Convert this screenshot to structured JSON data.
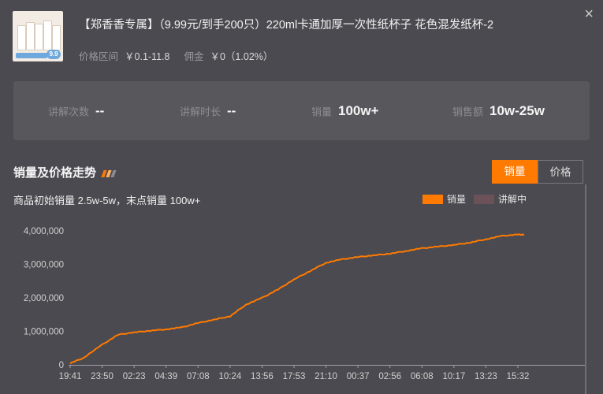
{
  "product": {
    "title": "【郑香香专属】（9.99元/到手200只）220ml卡通加厚一次性纸杯子 花色混发纸杯-2",
    "thumb_tag": "9.9",
    "price_label": "价格区间",
    "price_value": "￥0.1-11.8",
    "commission_label": "佣金",
    "commission_value": "￥0（1.02%）",
    "close_icon": "×"
  },
  "stats": [
    {
      "label": "讲解次数",
      "value": "--"
    },
    {
      "label": "讲解时长",
      "value": "--"
    },
    {
      "label": "销量",
      "value": "100w+"
    },
    {
      "label": "销售额",
      "value": "10w-25w"
    }
  ],
  "section": {
    "title": "销量及价格走势",
    "tabs": [
      {
        "label": "销量",
        "active": true
      },
      {
        "label": "价格",
        "active": false
      }
    ],
    "subline": "商品初始销量  2.5w-5w，末点销量  100w+",
    "legend": [
      {
        "name": "销量",
        "color": "#ff7a00"
      },
      {
        "name": "讲解中",
        "color": "#6b5258"
      }
    ]
  },
  "colors": {
    "accent": "#ff7a00",
    "bg": "#4b4a50",
    "deco1": "#ff7a00",
    "deco2": "#ffb066",
    "deco3": "#8a8a90"
  },
  "chart_data": {
    "type": "line",
    "yticks": [
      "4,000,000",
      "3,000,000",
      "2,000,000",
      "1,000,000",
      "0"
    ],
    "ytick_values": [
      4000000,
      3000000,
      2000000,
      1000000,
      0
    ],
    "ylim": [
      0,
      4000000
    ],
    "xticks": [
      "19:41",
      "23:50",
      "02:23",
      "04:39",
      "07:08",
      "10:24",
      "13:56",
      "17:53",
      "21:10",
      "00:37",
      "02:56",
      "06:08",
      "10:17",
      "13:23",
      "15:32"
    ],
    "series": [
      {
        "name": "销量",
        "x": [
          0,
          0.4,
          1,
          1.5,
          2,
          2.5,
          3,
          3.5,
          4,
          4.5,
          5,
          5.5,
          6,
          6.5,
          7,
          7.5,
          8,
          8.5,
          9,
          9.5,
          10,
          10.5,
          11,
          11.5,
          12,
          12.5,
          13,
          13.5,
          14,
          14.2
        ],
        "values": [
          50000,
          200000,
          600000,
          900000,
          970000,
          1020000,
          1060000,
          1120000,
          1250000,
          1350000,
          1450000,
          1800000,
          2000000,
          2250000,
          2550000,
          2800000,
          3050000,
          3150000,
          3220000,
          3270000,
          3320000,
          3400000,
          3480000,
          3530000,
          3580000,
          3650000,
          3750000,
          3850000,
          3890000,
          3890000
        ]
      }
    ]
  }
}
